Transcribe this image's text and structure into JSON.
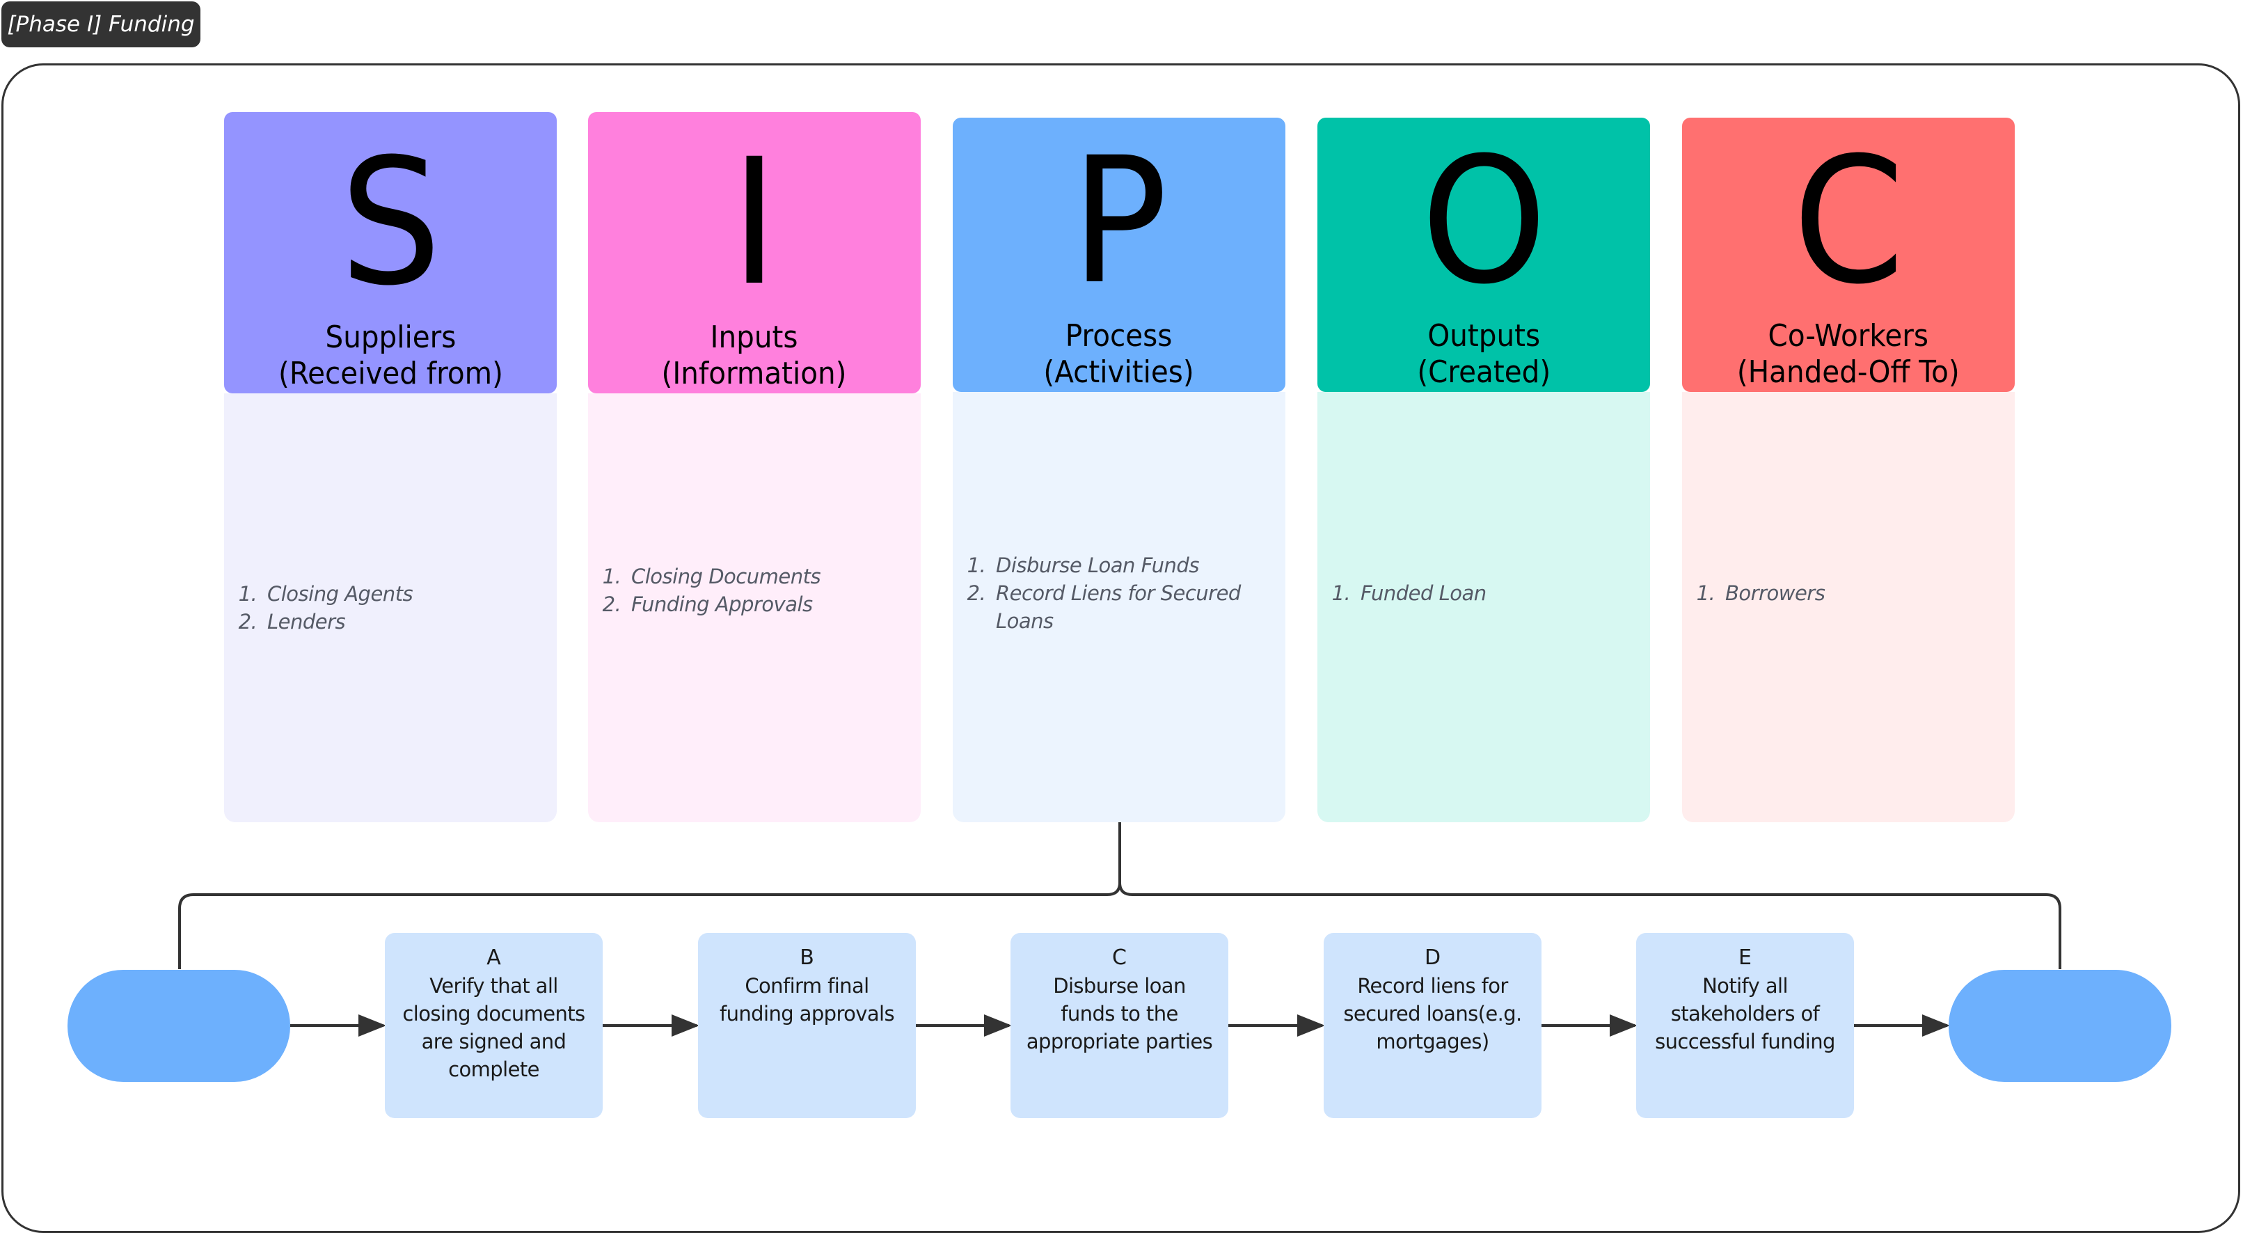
{
  "frame": {
    "title": "[Phase I] Funding"
  },
  "colors": {
    "connector": "#333333",
    "terminal": "#6db0fd",
    "step_box": "#cfe4fd"
  },
  "sipoc": [
    {
      "letter": "S",
      "title_line1": "Suppliers",
      "title_line2": "(Received from)",
      "header_color": "#9494ff",
      "body_color": "#f0f0fd",
      "items": [
        "Closing Agents",
        "Lenders"
      ]
    },
    {
      "letter": "I",
      "title_line1": "Inputs",
      "title_line2": "(Information)",
      "header_color": "#ff80dd",
      "body_color": "#ffeefa",
      "items": [
        "Closing Documents",
        "Funding Approvals"
      ]
    },
    {
      "letter": "P",
      "title_line1": "Process",
      "title_line2": "(Activities)",
      "header_color": "#6db0fd",
      "body_color": "#ecf4fe",
      "items": [
        "Disburse Loan Funds",
        "Record Liens for Secured Loans"
      ]
    },
    {
      "letter": "O",
      "title_line1": "Outputs",
      "title_line2": "(Created)",
      "header_color": "#00c2a8",
      "body_color": "#d7f8f2",
      "items": [
        "Funded Loan"
      ]
    },
    {
      "letter": "C",
      "title_line1": "Co-Workers",
      "title_line2": "(Handed-Off To)",
      "header_color": "#ff7070",
      "body_color": "#ffeded",
      "items": [
        "Borrowers"
      ]
    }
  ],
  "process_steps": [
    {
      "label": "A",
      "text": "Verify that all closing documents are signed and complete"
    },
    {
      "label": "B",
      "text": "Confirm final funding approvals"
    },
    {
      "label": "C",
      "text": "Disburse loan funds to the appropriate parties"
    },
    {
      "label": "D",
      "text": "Record liens for secured loans(e.g. mortgages)"
    },
    {
      "label": "E",
      "text": "Notify all stakeholders of successful funding"
    }
  ],
  "terminals": {
    "start_label": "",
    "end_label": ""
  }
}
